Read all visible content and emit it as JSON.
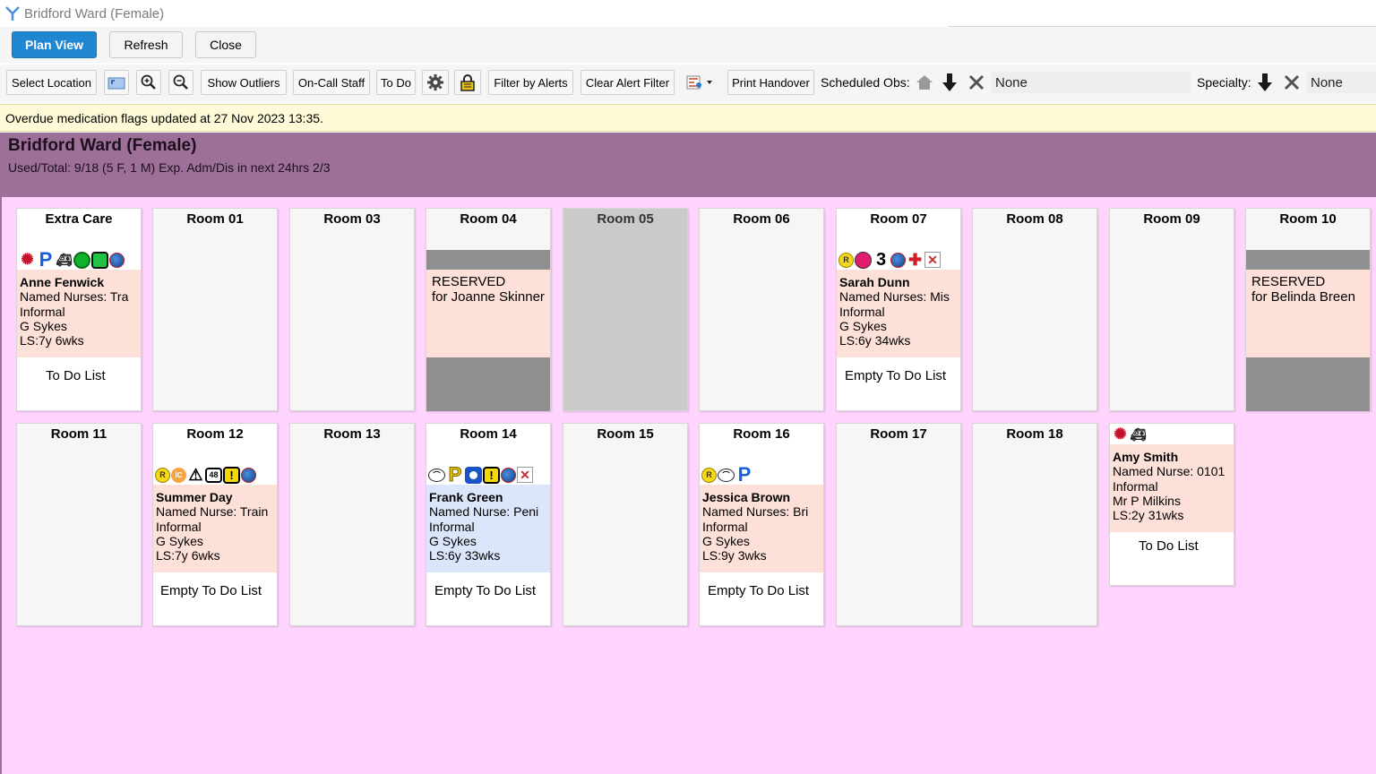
{
  "window": {
    "title": "Bridford Ward (Female)"
  },
  "topbar": {
    "plan_view": "Plan View",
    "refresh": "Refresh",
    "close": "Close"
  },
  "toolbar": {
    "select_location": "Select Location",
    "show_outliers": "Show Outliers",
    "on_call_staff": "On-Call Staff",
    "to_do": "To Do",
    "filter_by_alerts": "Filter by Alerts",
    "clear_alert_filter": "Clear Alert Filter",
    "print_handover": "Print Handover",
    "scheduled_obs_label": "Scheduled Obs:",
    "scheduled_obs_value": "None",
    "specialty_label": "Specialty:",
    "specialty_value": "None"
  },
  "notice": "Overdue medication flags updated at 27 Nov 2023 13:35.",
  "ward": {
    "name": "Bridford Ward (Female)",
    "summary": "Used/Total: 9/18 (5 F, 1 M) Exp. Adm/Dis in next 24hrs 2/3"
  },
  "rooms": {
    "extra_care": {
      "name": "Extra Care",
      "patient": {
        "name": "Anne Fenwick",
        "nurses": "Named Nurses: Tra",
        "status": "Informal",
        "doctor": "G Sykes",
        "los": "LS:7y 6wks"
      },
      "todo": "To Do List",
      "icons": [
        "bug-icon",
        "parking-icon",
        "ambulance-icon",
        "green-circle-icon",
        "green-square-icon",
        "globe-icon"
      ]
    },
    "room01": {
      "name": "Room 01"
    },
    "room03": {
      "name": "Room 03"
    },
    "room04": {
      "name": "Room 04",
      "reserved": "RESERVED",
      "reserved_for": "for Joanne Skinner"
    },
    "room05": {
      "name": "Room 05"
    },
    "room06": {
      "name": "Room 06"
    },
    "room07": {
      "name": "Room 07",
      "patient": {
        "name": "Sarah Dunn",
        "nurses": "Named Nurses: Mis",
        "status": "Informal",
        "doctor": "G Sykes",
        "los": "LS:6y 34wks"
      },
      "todo": "Empty To Do List",
      "icons": [
        "yellow-r-icon",
        "pink-circle-icon",
        "three-icon",
        "globe-icon",
        "cross-icon",
        "x-box-icon"
      ]
    },
    "room08": {
      "name": "Room 08"
    },
    "room09": {
      "name": "Room 09"
    },
    "room10": {
      "name": "Room 10",
      "reserved": "RESERVED",
      "reserved_for": "for Belinda Breen"
    },
    "room11": {
      "name": "Room 11"
    },
    "room12": {
      "name": "Room 12",
      "patient": {
        "name": "Summer Day",
        "nurses": "Named Nurse: Train",
        "status": "Informal",
        "doctor": "G Sykes",
        "los": "LS:7y 6wks"
      },
      "todo": "Empty To Do List",
      "icons": [
        "yellow-r-icon",
        "orange-ic-icon",
        "warning-icon",
        "48-icon",
        "yellow-alert-icon",
        "globe-icon"
      ]
    },
    "room13": {
      "name": "Room 13"
    },
    "room14": {
      "name": "Room 14",
      "patient": {
        "name": "Frank Green",
        "nurses": "Named Nurse: Peni",
        "status": "Informal",
        "doctor": "G Sykes",
        "los": "LS:6y 33wks"
      },
      "todo": "Empty To Do List",
      "icons": [
        "nose-icon",
        "yellow-p-icon",
        "blue-o-icon",
        "yellow-alert-icon",
        "globe-icon",
        "x-box-icon"
      ]
    },
    "room15": {
      "name": "Room 15"
    },
    "room16": {
      "name": "Room 16",
      "patient": {
        "name": "Jessica Brown",
        "nurses": "Named Nurses: Bri",
        "status": "Informal",
        "doctor": "G Sykes",
        "los": "LS:9y 3wks"
      },
      "todo": "Empty To Do List",
      "icons": [
        "yellow-r-icon",
        "nose-icon",
        "parking-icon"
      ]
    },
    "room17": {
      "name": "Room 17"
    },
    "room18": {
      "name": "Room 18"
    },
    "outlier": {
      "patient": {
        "name": "Amy Smith",
        "nurses": "Named Nurse: 0101",
        "status": "Informal",
        "doctor": "Mr P Milkins",
        "los": "LS:2y 31wks"
      },
      "todo": "To Do List",
      "icons": [
        "bug-icon",
        "ambulance-icon"
      ]
    }
  },
  "icon_glyphs": {
    "yellow_r": "R",
    "orange_ic": "IC",
    "ic48": "48",
    "alert": "!",
    "three": "3",
    "x": "✕",
    "cross": "✚"
  }
}
